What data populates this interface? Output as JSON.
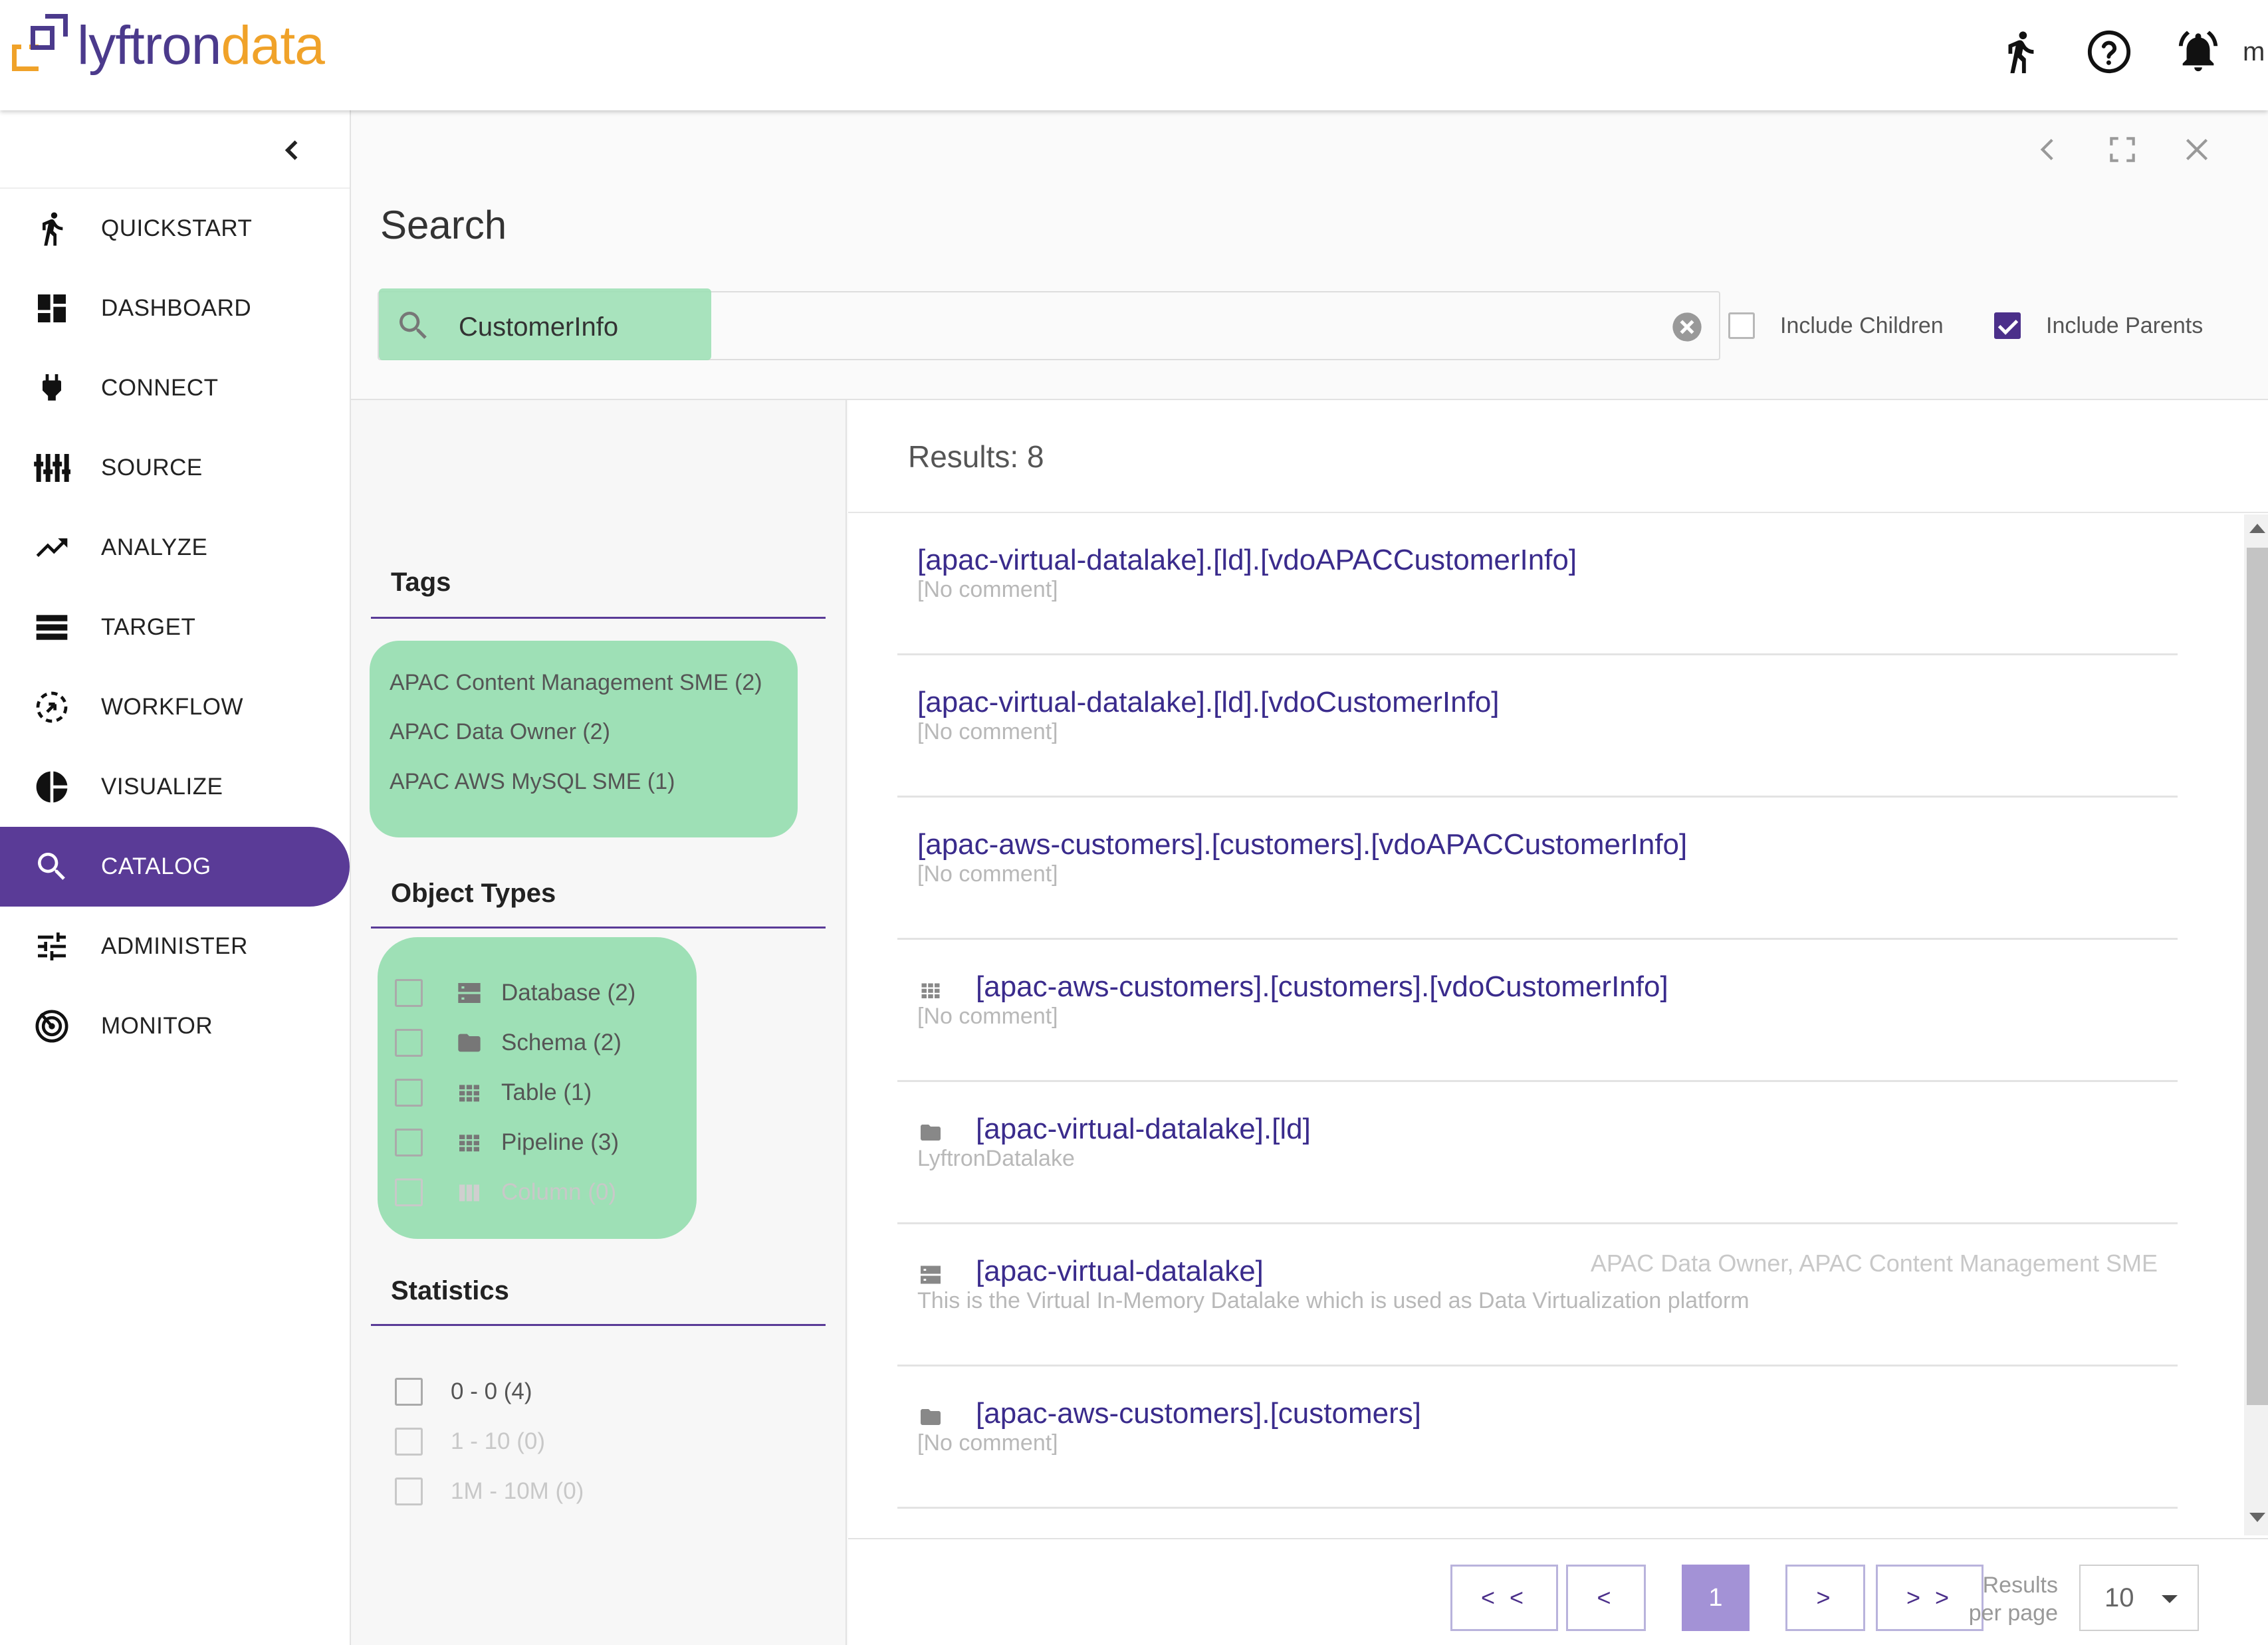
{
  "app": {
    "logo_text_a": "lyftron",
    "logo_text_b": "data",
    "brand_purple": "#5a3b97",
    "brand_orange": "#f0a229"
  },
  "topbar": {
    "icons": [
      "run-icon",
      "help-icon",
      "bell-icon"
    ],
    "user_initial": "m"
  },
  "sidebar": {
    "items": [
      {
        "label": "QUICKSTART",
        "icon": "run-icon"
      },
      {
        "label": "DASHBOARD",
        "icon": "dashboard-icon"
      },
      {
        "label": "CONNECT",
        "icon": "plug-icon"
      },
      {
        "label": "SOURCE",
        "icon": "source-icon"
      },
      {
        "label": "ANALYZE",
        "icon": "trending-up-icon"
      },
      {
        "label": "TARGET",
        "icon": "target-list-icon"
      },
      {
        "label": "WORKFLOW",
        "icon": "workflow-icon"
      },
      {
        "label": "VISUALIZE",
        "icon": "pie-chart-icon"
      },
      {
        "label": "CATALOG",
        "icon": "search-icon",
        "active": true
      },
      {
        "label": "ADMINISTER",
        "icon": "sliders-icon"
      },
      {
        "label": "MONITOR",
        "icon": "radar-icon"
      }
    ]
  },
  "main": {
    "title": "Search",
    "search": {
      "value": "CustomerInfo",
      "placeholder": ""
    },
    "include_children": {
      "label": "Include Children",
      "checked": false
    },
    "include_parents": {
      "label": "Include Parents",
      "checked": true
    }
  },
  "filters": {
    "tags": {
      "heading": "Tags",
      "items": [
        "APAC Content Management SME (2)",
        "APAC Data Owner (2)",
        "APAC AWS MySQL SME (1)"
      ]
    },
    "object_types": {
      "heading": "Object Types",
      "items": [
        {
          "label": "Database (2)",
          "icon": "database-icon"
        },
        {
          "label": "Schema (2)",
          "icon": "folder-icon"
        },
        {
          "label": "Table (1)",
          "icon": "table-icon"
        },
        {
          "label": "Pipeline (3)",
          "icon": "table-icon"
        },
        {
          "label": "Column (0)",
          "icon": "column-icon",
          "disabled": true
        }
      ]
    },
    "statistics": {
      "heading": "Statistics",
      "items": [
        {
          "label": "0 - 0 (4)"
        },
        {
          "label": "1 - 10 (0)",
          "disabled": true
        },
        {
          "label": "1M - 10M (0)",
          "disabled": true
        }
      ]
    }
  },
  "results": {
    "count_label": "Results: 8",
    "items": [
      {
        "title": "[apac-virtual-datalake].[ld].[vdoAPACCustomerInfo]",
        "subtitle": "[No comment]",
        "icon": null,
        "tags": ""
      },
      {
        "title": "[apac-virtual-datalake].[ld].[vdoCustomerInfo]",
        "subtitle": "[No comment]",
        "icon": null,
        "tags": ""
      },
      {
        "title": "[apac-aws-customers].[customers].[vdoAPACCustomerInfo]",
        "subtitle": "[No comment]",
        "icon": null,
        "tags": ""
      },
      {
        "title": "[apac-aws-customers].[customers].[vdoCustomerInfo]",
        "subtitle": "[No comment]",
        "icon": "table-icon",
        "tags": ""
      },
      {
        "title": "[apac-virtual-datalake].[ld]",
        "subtitle": "LyftronDatalake",
        "icon": "folder-icon",
        "tags": ""
      },
      {
        "title": "[apac-virtual-datalake]",
        "subtitle": "This is the Virtual In-Memory Datalake which is used as Data Virtualization platform",
        "icon": "database-icon",
        "tags": "APAC Data Owner, APAC Content Management SME"
      },
      {
        "title": "[apac-aws-customers].[customers]",
        "subtitle": "[No comment]",
        "icon": "folder-icon",
        "tags": ""
      }
    ],
    "pager": {
      "first": "< <",
      "prev": "<",
      "current": "1",
      "next": ">",
      "last": "> >",
      "per_page_label": "Results per page",
      "per_page_value": "10"
    }
  }
}
